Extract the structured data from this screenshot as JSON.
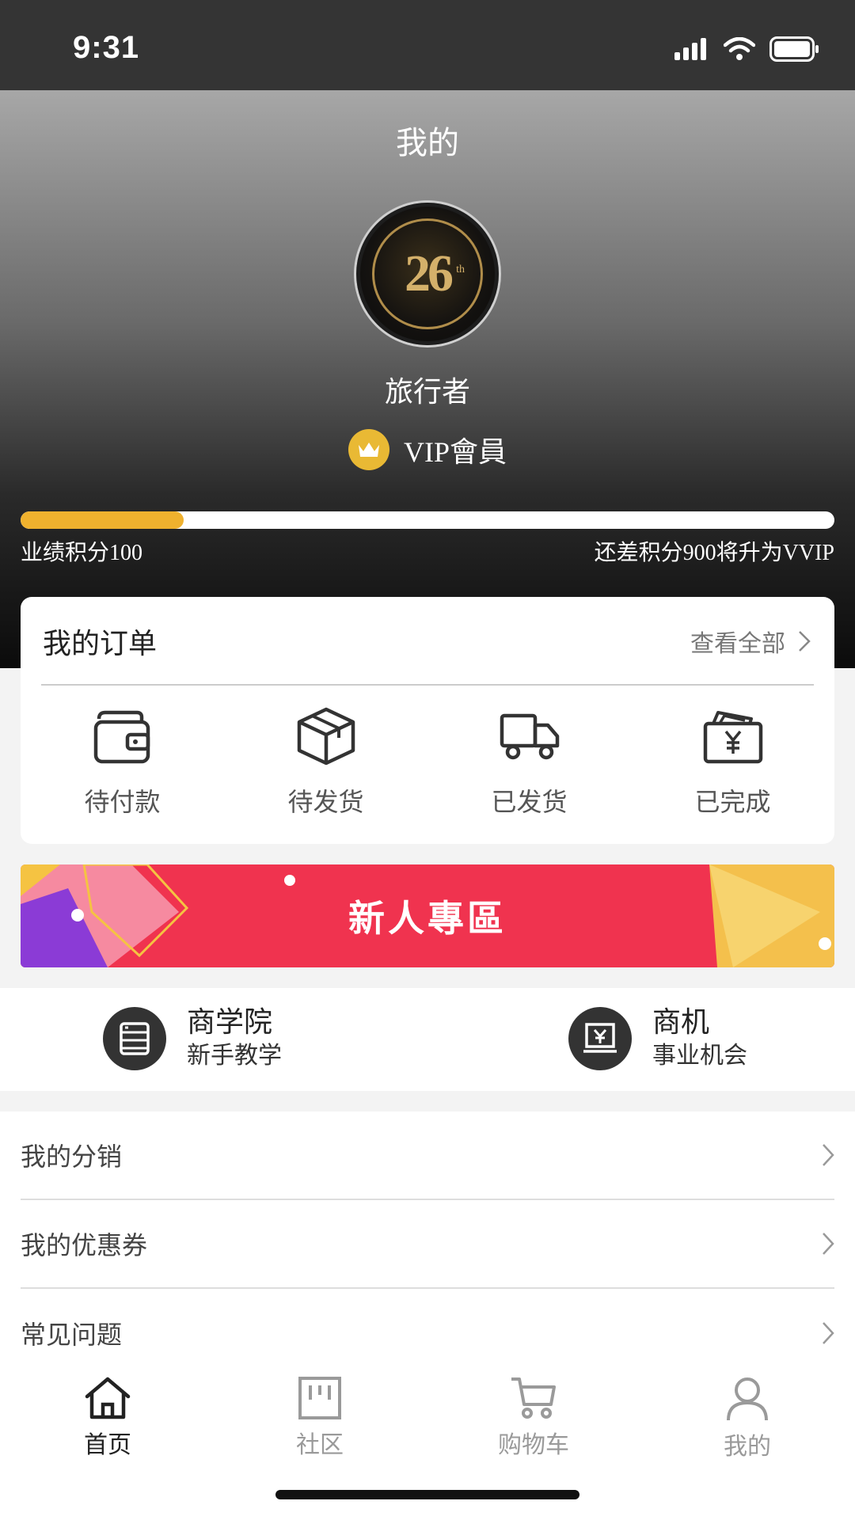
{
  "status_bar": {
    "time": "9:31"
  },
  "header": {
    "title": "我的",
    "avatar_text": "26",
    "avatar_sup": "th",
    "username": "旅行者",
    "vip_label": "VIP會員",
    "progress": 0.2,
    "points_text": "业绩积分100",
    "upgrade_text": "还差积分900将升为VVIP"
  },
  "orders": {
    "title": "我的订单",
    "view_all": "查看全部",
    "items": [
      {
        "label": "待付款",
        "icon": "wallet-icon"
      },
      {
        "label": "待发货",
        "icon": "box-icon"
      },
      {
        "label": "已发货",
        "icon": "truck-icon"
      },
      {
        "label": "已完成",
        "icon": "yen-wallet-icon"
      }
    ]
  },
  "banner": {
    "text": "新人專區",
    "color": "#f0334f"
  },
  "services": [
    {
      "title": "商学院",
      "subtitle": "新手教学",
      "icon": "document-list-icon"
    },
    {
      "title": "商机",
      "subtitle": "事业机会",
      "icon": "yen-board-icon"
    }
  ],
  "menu": [
    {
      "label": "我的分销"
    },
    {
      "label": "我的优惠券"
    },
    {
      "label": "常见问题"
    }
  ],
  "tabs": [
    {
      "label": "首页",
      "icon": "home-icon",
      "active": true
    },
    {
      "label": "社区",
      "icon": "community-icon",
      "active": false
    },
    {
      "label": "购物车",
      "icon": "cart-icon",
      "active": false
    },
    {
      "label": "我的",
      "icon": "user-icon",
      "active": false
    }
  ],
  "colors": {
    "accent": "#efb12e",
    "tab_active": "#222222",
    "tab_inactive": "#9a9a9a"
  }
}
